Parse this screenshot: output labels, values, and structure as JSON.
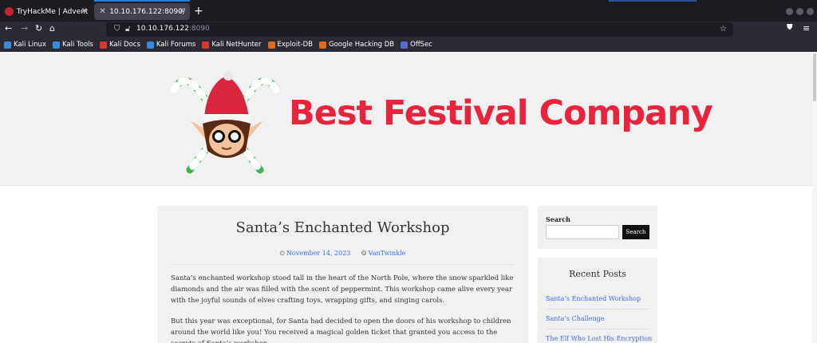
{
  "browser": {
    "tabs": [
      {
        "title": "TryHackMe | Advent of Cy",
        "close": "×"
      },
      {
        "title": "10.10.176.122:8090/",
        "close": "×"
      }
    ],
    "new_tab": "+",
    "url_host": "10.10.176.122",
    "url_port": ":8090",
    "bookmarks": [
      {
        "label": "Kali Linux",
        "color": "#3a8bdc"
      },
      {
        "label": "Kali Tools",
        "color": "#3a8bdc"
      },
      {
        "label": "Kali Docs",
        "color": "#d23b2e"
      },
      {
        "label": "Kali Forums",
        "color": "#3a8bdc"
      },
      {
        "label": "Kali NetHunter",
        "color": "#d23b2e"
      },
      {
        "label": "Exploit-DB",
        "color": "#e06a1b"
      },
      {
        "label": "Google Hacking DB",
        "color": "#e06a1b"
      },
      {
        "label": "OffSec",
        "color": "#5b6ad0"
      }
    ]
  },
  "site": {
    "brand": "Best Festival Company",
    "brand_color": "#e8243c"
  },
  "article": {
    "title": "Santa’s Enchanted Workshop",
    "date": "November 14, 2023",
    "author": "VanTwinkle",
    "paragraphs": [
      "Santa’s enchanted workshop stood tall in the heart of the North Pole, where the snow sparkled like diamonds and the air was filled with the scent of peppermint. This workshop came alive every year with the joyful sounds of elves crafting toys, wrapping gifts, and singing carols.",
      "But this year was exceptional, for Santa had decided to open the doors of his workshop to children around the world like you! You received a magical golden ticket that granted you access to the secrets of Santa’s workshop."
    ]
  },
  "sidebar": {
    "search_label": "Search",
    "search_button": "Search",
    "recent_heading": "Recent Posts",
    "recent_posts": [
      "Santa’s Enchanted Workshop",
      "Santa’s Challenge",
      "The Elf Who Lost His Encryption"
    ]
  }
}
